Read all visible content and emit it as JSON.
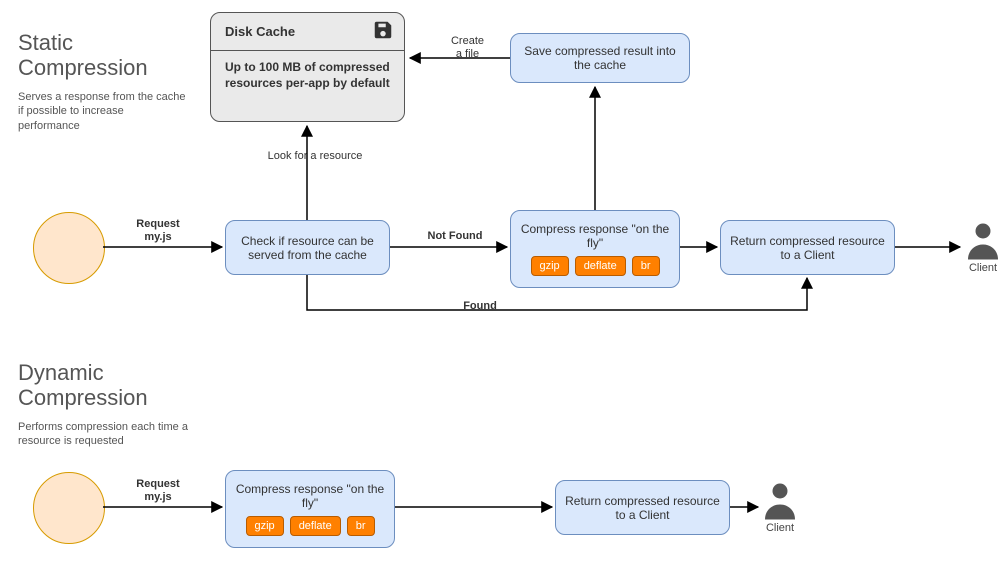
{
  "static": {
    "title_line1": "Static",
    "title_line2": "Compression",
    "subtitle": "Serves a response from the cache if possible to increase performance",
    "request_label": "Request\nmy.js",
    "check_cache": "Check if resource can be served from the cache",
    "disk_cache_title": "Disk Cache",
    "disk_cache_body": "Up to 100 MB of compressed resources per-app by default",
    "look_label": "Look for a resource",
    "not_found": "Not Found",
    "found": "Found",
    "compress": "Compress response \"on the fly\"",
    "chips": {
      "gzip": "gzip",
      "deflate": "deflate",
      "br": "br"
    },
    "save": "Save compressed result into the cache",
    "create_file": "Create\na file",
    "return": "Return compressed resource to a Client",
    "client": "Client"
  },
  "dynamic": {
    "title_line1": "Dynamic",
    "title_line2": "Compression",
    "subtitle": "Performs compression each time a resource is requested",
    "request_label": "Request\nmy.js",
    "compress": "Compress response \"on the fly\"",
    "chips": {
      "gzip": "gzip",
      "deflate": "deflate",
      "br": "br"
    },
    "return": "Return compressed resource to a Client",
    "client": "Client"
  }
}
